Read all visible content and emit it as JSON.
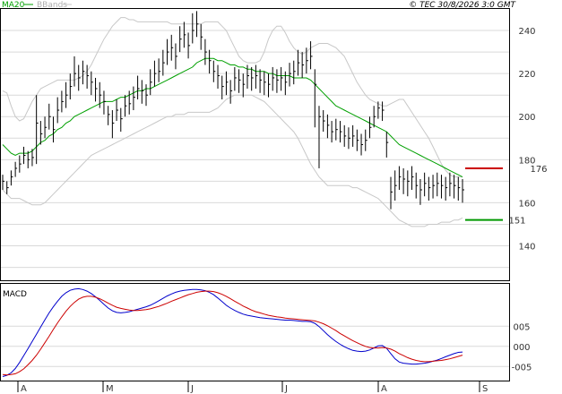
{
  "header": {
    "legend_ma20": "MA20",
    "legend_bbands": "BBands",
    "copyright": "© TEC 30/8/2026 3:0 GMT"
  },
  "colors": {
    "price_bars": "#000000",
    "ma20": "#00a000",
    "bbands": "#c8c8c8",
    "resistance": "#cc0000",
    "support": "#009900",
    "macd_line": "#0000cc",
    "macd_signal": "#cc0000",
    "grid": "#d9d9d9"
  },
  "chart_data": [
    {
      "type": "ohlc",
      "ylim": [
        124,
        250
      ],
      "yticks": [
        140,
        160,
        180,
        200,
        220,
        240
      ],
      "x_month_labels": [
        "A",
        "M",
        "J",
        "J",
        "A",
        "S"
      ],
      "levels": [
        {
          "label": "176",
          "value": 176,
          "color": "#cc0000"
        },
        {
          "label": "151",
          "value": 152,
          "color": "#009900"
        }
      ],
      "close": [
        170,
        167,
        172,
        176,
        178,
        182,
        180,
        181,
        197,
        192,
        195,
        200,
        194,
        203,
        207,
        210,
        214,
        220,
        218,
        221,
        219,
        216,
        213,
        210,
        207,
        201,
        197,
        203,
        199,
        205,
        206,
        209,
        213,
        212,
        210,
        216,
        220,
        221,
        225,
        230,
        232,
        228,
        236,
        238,
        233,
        240,
        243,
        237,
        230,
        226,
        221,
        219,
        214,
        216,
        212,
        218,
        217,
        215,
        219,
        218,
        219,
        217,
        216,
        215,
        218,
        217,
        218,
        216,
        220,
        221,
        225,
        224,
        226,
        228,
        215,
        200,
        198,
        196,
        193,
        194,
        193,
        191,
        190,
        191,
        189,
        187,
        189,
        195,
        200,
        204,
        203,
        188,
        165,
        168,
        172,
        171,
        170,
        172,
        168,
        166,
        169,
        167,
        168,
        169,
        168,
        167,
        169,
        168,
        167,
        166
      ],
      "high": [
        173,
        170,
        175,
        179,
        182,
        186,
        184,
        185,
        210,
        198,
        200,
        206,
        200,
        209,
        212,
        216,
        220,
        228,
        224,
        226,
        224,
        221,
        218,
        216,
        212,
        205,
        203,
        208,
        204,
        210,
        212,
        214,
        219,
        217,
        215,
        222,
        226,
        227,
        231,
        236,
        238,
        234,
        242,
        244,
        239,
        248,
        249,
        243,
        236,
        231,
        226,
        224,
        219,
        221,
        217,
        223,
        222,
        220,
        224,
        223,
        224,
        222,
        221,
        220,
        223,
        222,
        223,
        221,
        225,
        226,
        231,
        230,
        232,
        235,
        222,
        205,
        203,
        201,
        198,
        199,
        198,
        196,
        195,
        196,
        194,
        192,
        194,
        200,
        205,
        207,
        207,
        193,
        172,
        175,
        177,
        176,
        175,
        177,
        174,
        171,
        174,
        172,
        173,
        174,
        173,
        172,
        174,
        173,
        172,
        171
      ],
      "low": [
        166,
        164,
        168,
        172,
        174,
        178,
        176,
        177,
        178,
        187,
        190,
        194,
        188,
        197,
        202,
        204,
        208,
        214,
        212,
        215,
        213,
        210,
        207,
        204,
        201,
        196,
        190,
        198,
        193,
        200,
        201,
        203,
        208,
        206,
        205,
        210,
        214,
        216,
        219,
        224,
        226,
        222,
        230,
        232,
        227,
        234,
        237,
        231,
        224,
        220,
        216,
        213,
        208,
        210,
        206,
        212,
        211,
        209,
        213,
        212,
        213,
        211,
        210,
        209,
        212,
        211,
        212,
        210,
        214,
        215,
        219,
        218,
        220,
        222,
        195,
        176,
        193,
        190,
        188,
        189,
        188,
        186,
        185,
        186,
        184,
        182,
        184,
        190,
        195,
        199,
        198,
        181,
        157,
        161,
        166,
        164,
        163,
        166,
        162,
        159,
        163,
        161,
        162,
        163,
        162,
        161,
        163,
        162,
        161,
        160
      ],
      "ma20": [
        187,
        185,
        183,
        182,
        183,
        183,
        183,
        184,
        186,
        188,
        189,
        191,
        192,
        194,
        195,
        197,
        198,
        200,
        201,
        202,
        203,
        204,
        205,
        206,
        207,
        207,
        207,
        208,
        209,
        209,
        210,
        211,
        212,
        212,
        213,
        213,
        214,
        215,
        216,
        217,
        218,
        219,
        220,
        221,
        222,
        223,
        225,
        226,
        227,
        227,
        227,
        226,
        226,
        225,
        224,
        224,
        223,
        223,
        222,
        222,
        221,
        221,
        221,
        220,
        220,
        219,
        219,
        219,
        219,
        218,
        218,
        218,
        218,
        217,
        215,
        213,
        211,
        209,
        207,
        205,
        204,
        203,
        202,
        201,
        200,
        199,
        198,
        197,
        196,
        195,
        194,
        193,
        191,
        189,
        187,
        186,
        185,
        184,
        183,
        182,
        181,
        180,
        179,
        178,
        177,
        176,
        175,
        174,
        173,
        172
      ],
      "bb_upper": [
        212,
        211,
        205,
        200,
        198,
        199,
        203,
        207,
        210,
        213,
        214,
        215,
        216,
        217,
        217,
        217,
        217,
        217,
        218,
        219,
        221,
        224,
        228,
        232,
        236,
        239,
        242,
        244,
        246,
        246,
        245,
        245,
        244,
        244,
        244,
        244,
        244,
        244,
        244,
        244,
        243,
        243,
        243,
        243,
        243,
        243,
        243,
        243,
        244,
        244,
        244,
        244,
        242,
        240,
        236,
        232,
        228,
        226,
        225,
        225,
        225,
        226,
        230,
        236,
        240,
        242,
        242,
        239,
        235,
        232,
        230,
        229,
        230,
        232,
        233,
        234,
        234,
        234,
        233,
        232,
        230,
        228,
        224,
        220,
        216,
        213,
        210,
        208,
        207,
        206,
        205,
        205,
        206,
        207,
        208,
        208,
        205,
        202,
        199,
        196,
        193,
        190,
        186,
        182,
        178,
        175,
        173,
        172,
        172,
        172
      ],
      "bb_lower": [
        166,
        164,
        162,
        162,
        162,
        161,
        160,
        159,
        159,
        159,
        160,
        162,
        164,
        166,
        168,
        170,
        172,
        174,
        176,
        178,
        180,
        182,
        183,
        184,
        185,
        186,
        187,
        188,
        189,
        190,
        191,
        192,
        193,
        194,
        195,
        196,
        197,
        198,
        199,
        200,
        200,
        201,
        201,
        201,
        202,
        202,
        202,
        202,
        202,
        202,
        203,
        204,
        206,
        208,
        209,
        210,
        210,
        210,
        210,
        210,
        209,
        208,
        207,
        205,
        203,
        201,
        199,
        197,
        195,
        193,
        190,
        186,
        182,
        178,
        175,
        172,
        170,
        168,
        168,
        168,
        168,
        168,
        168,
        167,
        167,
        166,
        165,
        164,
        163,
        162,
        160,
        158,
        156,
        154,
        152,
        151,
        150,
        149,
        149,
        149,
        149,
        150,
        150,
        150,
        151,
        151,
        151,
        152,
        152,
        153
      ]
    },
    {
      "type": "line",
      "title": "MACD",
      "ylim": [
        -0.85,
        1.55
      ],
      "yticks": [
        -0.05,
        0,
        0.05
      ],
      "ytick_labels": [
        "-005",
        "000",
        "005"
      ],
      "series": [
        {
          "values": [
            -0.75,
            -0.72,
            -0.66,
            -0.55,
            -0.4,
            -0.23,
            -0.06,
            0.12,
            0.3,
            0.48,
            0.66,
            0.83,
            0.98,
            1.12,
            1.24,
            1.33,
            1.39,
            1.42,
            1.43,
            1.41,
            1.37,
            1.31,
            1.23,
            1.14,
            1.04,
            0.95,
            0.88,
            0.84,
            0.83,
            0.84,
            0.86,
            0.89,
            0.92,
            0.95,
            0.98,
            1.02,
            1.07,
            1.13,
            1.19,
            1.25,
            1.3,
            1.34,
            1.37,
            1.39,
            1.4,
            1.41,
            1.41,
            1.4,
            1.38,
            1.34,
            1.28,
            1.2,
            1.11,
            1.02,
            0.95,
            0.89,
            0.84,
            0.8,
            0.77,
            0.75,
            0.73,
            0.71,
            0.7,
            0.69,
            0.68,
            0.67,
            0.66,
            0.65,
            0.65,
            0.64,
            0.63,
            0.62,
            0.62,
            0.61,
            0.57,
            0.49,
            0.39,
            0.29,
            0.2,
            0.12,
            0.05,
            -0.01,
            -0.06,
            -0.1,
            -0.12,
            -0.13,
            -0.12,
            -0.09,
            -0.04,
            0.01,
            0.02,
            -0.05,
            -0.18,
            -0.31,
            -0.39,
            -0.42,
            -0.43,
            -0.44,
            -0.44,
            -0.43,
            -0.42,
            -0.4,
            -0.37,
            -0.34,
            -0.3,
            -0.26,
            -0.22,
            -0.18,
            -0.15,
            -0.14
          ]
        },
        {
          "values": [
            -0.7,
            -0.71,
            -0.7,
            -0.68,
            -0.63,
            -0.56,
            -0.46,
            -0.35,
            -0.22,
            -0.07,
            0.09,
            0.25,
            0.42,
            0.58,
            0.73,
            0.87,
            0.99,
            1.09,
            1.17,
            1.22,
            1.24,
            1.24,
            1.22,
            1.18,
            1.13,
            1.07,
            1.02,
            0.97,
            0.94,
            0.92,
            0.9,
            0.89,
            0.89,
            0.9,
            0.91,
            0.93,
            0.96,
            0.99,
            1.03,
            1.07,
            1.12,
            1.16,
            1.2,
            1.24,
            1.28,
            1.31,
            1.34,
            1.36,
            1.37,
            1.37,
            1.36,
            1.33,
            1.29,
            1.24,
            1.18,
            1.12,
            1.06,
            1.0,
            0.95,
            0.9,
            0.86,
            0.83,
            0.8,
            0.77,
            0.75,
            0.73,
            0.72,
            0.7,
            0.69,
            0.68,
            0.67,
            0.66,
            0.65,
            0.64,
            0.63,
            0.6,
            0.56,
            0.51,
            0.45,
            0.39,
            0.32,
            0.26,
            0.2,
            0.14,
            0.09,
            0.04,
            0.0,
            -0.03,
            -0.04,
            -0.04,
            -0.03,
            -0.04,
            -0.07,
            -0.12,
            -0.18,
            -0.23,
            -0.28,
            -0.32,
            -0.35,
            -0.37,
            -0.38,
            -0.38,
            -0.37,
            -0.36,
            -0.35,
            -0.33,
            -0.31,
            -0.28,
            -0.25,
            -0.22
          ]
        }
      ]
    }
  ]
}
